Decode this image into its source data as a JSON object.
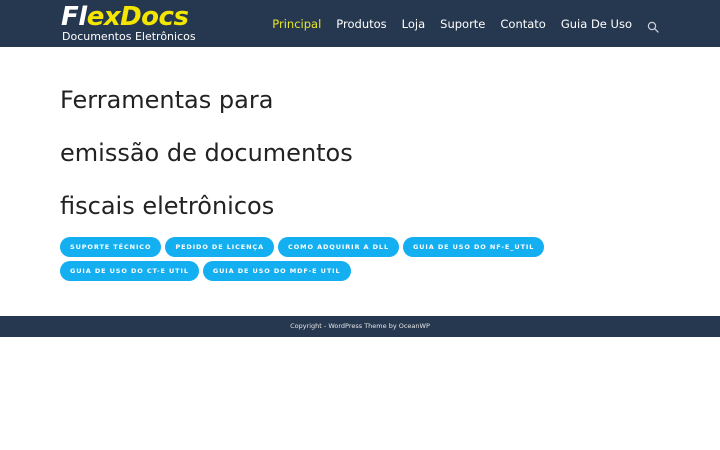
{
  "header": {
    "logo": {
      "part1": "Fl",
      "part2": "ex",
      "part3": "Docs",
      "subtitle": "Documentos Eletrônicos"
    },
    "nav": [
      {
        "label": "Principal",
        "active": true
      },
      {
        "label": "Produtos"
      },
      {
        "label": "Loja"
      },
      {
        "label": "Suporte"
      },
      {
        "label": "Contato"
      },
      {
        "label": "Guia De Uso"
      }
    ],
    "search_icon": "search-icon"
  },
  "hero": {
    "lines": [
      "Ferramentas para",
      "emissão de documentos",
      "fiscais eletrônicos"
    ]
  },
  "buttons": [
    "Suporte Técnico",
    "Pedido de licença",
    "Como adquirir a DLL",
    "Guia de uso do NF-e_Util",
    "Guia de uso do CT-e Util",
    "Guia de uso do MDF-e Util"
  ],
  "footer": {
    "text": "Copyright - WordPress Theme by OceanWP"
  },
  "colors": {
    "topbar": "#26384f",
    "accent_yellow": "#f4e600",
    "nav_active": "#e7e52a",
    "button_blue": "#13aff0"
  }
}
